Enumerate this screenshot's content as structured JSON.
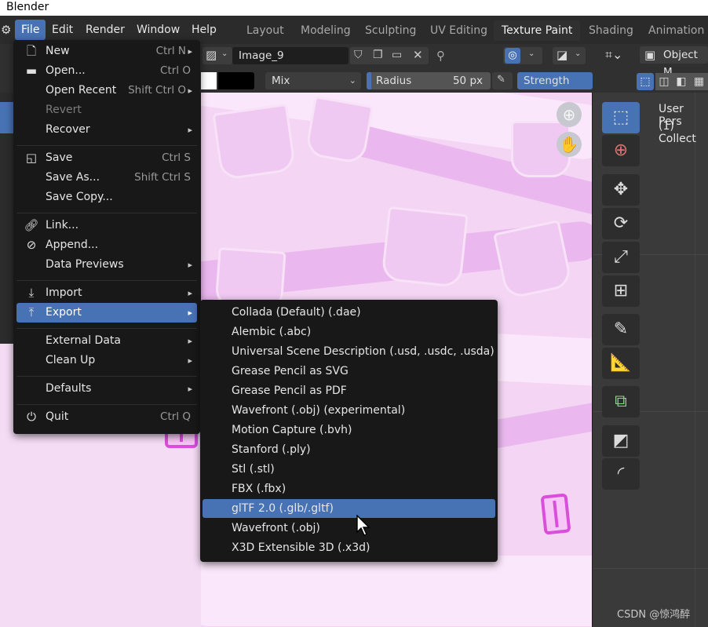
{
  "window": {
    "title": "Blender"
  },
  "menubar": {
    "menus": [
      "File",
      "Edit",
      "Render",
      "Window",
      "Help"
    ],
    "workspaces": [
      "Layout",
      "Modeling",
      "Sculpting",
      "UV Editing",
      "Texture Paint",
      "Shading",
      "Animation"
    ],
    "active_workspace": "Texture Paint"
  },
  "image_editor_header": {
    "image_name": "Image_9",
    "blend_mode": "Mix",
    "radius_label": "Radius",
    "radius_value": "50 px",
    "strength_label": "Strength"
  },
  "viewport_3d_header": {
    "mode": "Object M",
    "overlay_text_1": "User Pers",
    "overlay_text_2": "(1) Collect"
  },
  "file_menu": {
    "items": [
      {
        "label": "New",
        "shortcut": "Ctrl N",
        "icon": "new-file-icon",
        "submenu": true
      },
      {
        "label": "Open...",
        "shortcut": "Ctrl O",
        "icon": "folder-icon"
      },
      {
        "label": "Open Recent",
        "shortcut": "Shift Ctrl O",
        "submenu": true
      },
      {
        "label": "Revert",
        "disabled": true
      },
      {
        "label": "Recover",
        "submenu": true
      },
      {
        "label": "Save",
        "shortcut": "Ctrl S",
        "icon": "save-icon"
      },
      {
        "label": "Save As...",
        "shortcut": "Shift Ctrl S"
      },
      {
        "label": "Save Copy..."
      },
      {
        "label": "Link...",
        "icon": "link-icon"
      },
      {
        "label": "Append...",
        "icon": "append-icon"
      },
      {
        "label": "Data Previews",
        "submenu": true
      },
      {
        "label": "Import",
        "icon": "import-icon",
        "submenu": true
      },
      {
        "label": "Export",
        "icon": "export-icon",
        "submenu": true,
        "highlighted": true
      },
      {
        "label": "External Data",
        "submenu": true
      },
      {
        "label": "Clean Up",
        "submenu": true
      },
      {
        "label": "Defaults",
        "submenu": true
      },
      {
        "label": "Quit",
        "shortcut": "Ctrl Q",
        "icon": "power-icon"
      }
    ]
  },
  "export_submenu": {
    "items": [
      "Collada (Default) (.dae)",
      "Alembic (.abc)",
      "Universal Scene Description (.usd, .usdc, .usda)",
      "Grease Pencil as SVG",
      "Grease Pencil as PDF",
      "Wavefront (.obj) (experimental)",
      "Motion Capture (.bvh)",
      "Stanford (.ply)",
      "Stl (.stl)",
      "FBX (.fbx)",
      "glTF 2.0 (.glb/.gltf)",
      "Wavefront (.obj)",
      "X3D Extensible 3D (.x3d)"
    ],
    "highlighted": "glTF 2.0 (.glb/.gltf)"
  },
  "watermark": "CSDN @惊鸿醉",
  "colors": {
    "accent": "#4772b3",
    "menu_bg": "#181818",
    "header_bg": "#303030",
    "texture_pink": "#f4d6f4"
  }
}
